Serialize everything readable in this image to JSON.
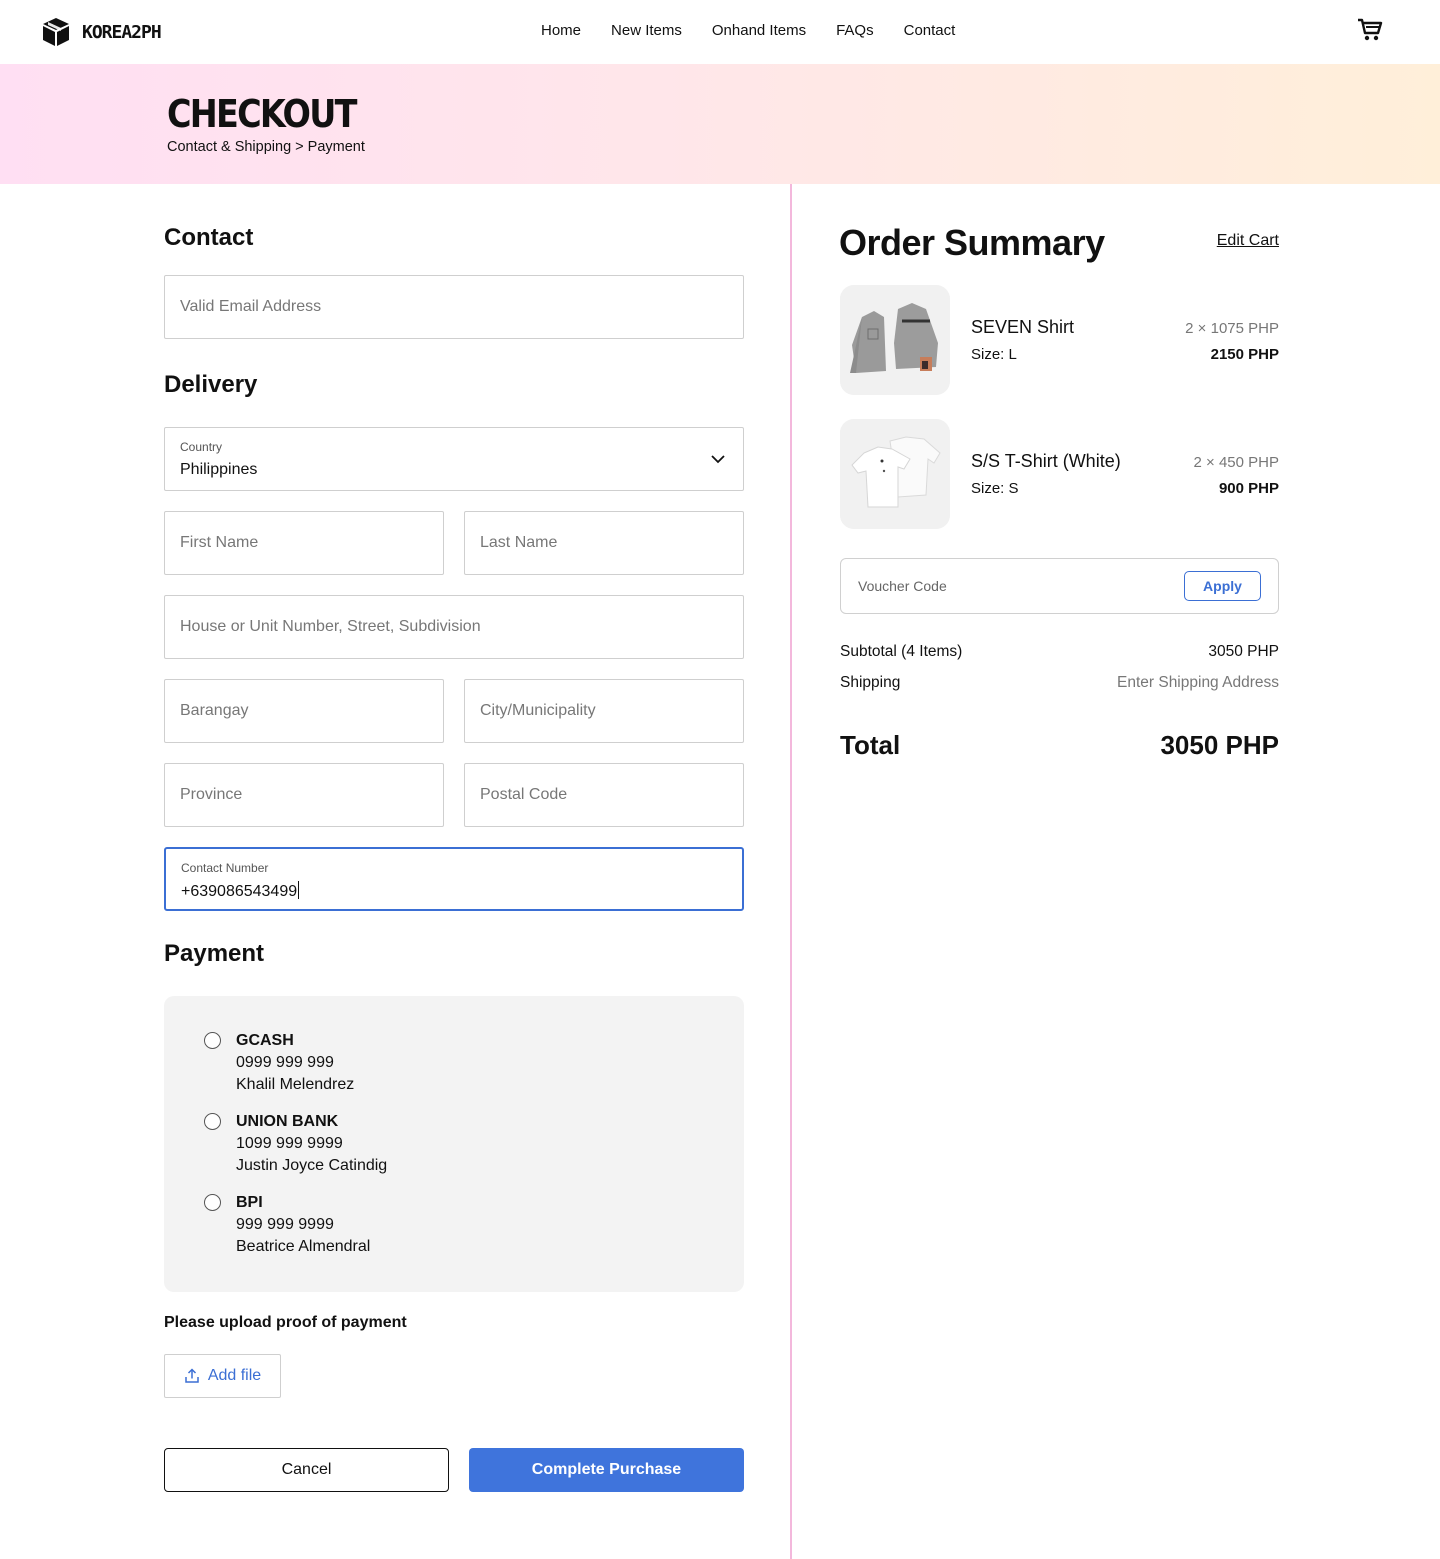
{
  "brand": {
    "name": "KOREA2PH"
  },
  "nav": {
    "links": [
      "Home",
      "New Items",
      "Onhand Items",
      "FAQs",
      "Contact"
    ]
  },
  "banner": {
    "title": "CHECKOUT",
    "breadcrumb": "Contact & Shipping > Payment"
  },
  "contact": {
    "title": "Contact",
    "email_placeholder": "Valid Email Address"
  },
  "delivery": {
    "title": "Delivery",
    "country_label": "Country",
    "country_value": "Philippines",
    "first_name_placeholder": "First Name",
    "last_name_placeholder": "Last Name",
    "address_placeholder": "House or Unit Number, Street, Subdivision",
    "barangay_placeholder": "Barangay",
    "city_placeholder": "City/Municipality",
    "province_placeholder": "Province",
    "postal_placeholder": "Postal Code",
    "contact_label": "Contact Number",
    "contact_value": "+639086543499"
  },
  "payment": {
    "title": "Payment",
    "options": [
      {
        "name": "GCASH",
        "number": "0999 999 999",
        "holder": "Khalil Melendrez"
      },
      {
        "name": "UNION BANK",
        "number": "1099 999 9999",
        "holder": "Justin Joyce Catindig"
      },
      {
        "name": "BPI",
        "number": "999 999 9999",
        "holder": "Beatrice Almendral"
      }
    ],
    "upload_label": "Please upload proof of payment",
    "add_file": "Add file"
  },
  "actions": {
    "cancel": "Cancel",
    "complete": "Complete Purchase"
  },
  "summary": {
    "title": "Order Summary",
    "edit_cart": "Edit Cart",
    "items": [
      {
        "name": "SEVEN Shirt",
        "size": "Size: L",
        "qty_price": "2 × 1075 PHP",
        "total": "2150 PHP"
      },
      {
        "name": "S/S T-Shirt (White)",
        "size": "Size: S",
        "qty_price": "2 × 450 PHP",
        "total": "900 PHP"
      }
    ],
    "voucher_placeholder": "Voucher Code",
    "apply": "Apply",
    "subtotal_label": "Subtotal (4 Items)",
    "subtotal_value": "3050 PHP",
    "shipping_label": "Shipping",
    "shipping_value": "Enter Shipping Address",
    "total_label": "Total",
    "total_value": "3050 PHP"
  },
  "colors": {
    "accent": "#3f74dc",
    "divider": "#f3b8dc",
    "banner_start": "#ffdff3",
    "banner_end": "#ffefd9"
  }
}
